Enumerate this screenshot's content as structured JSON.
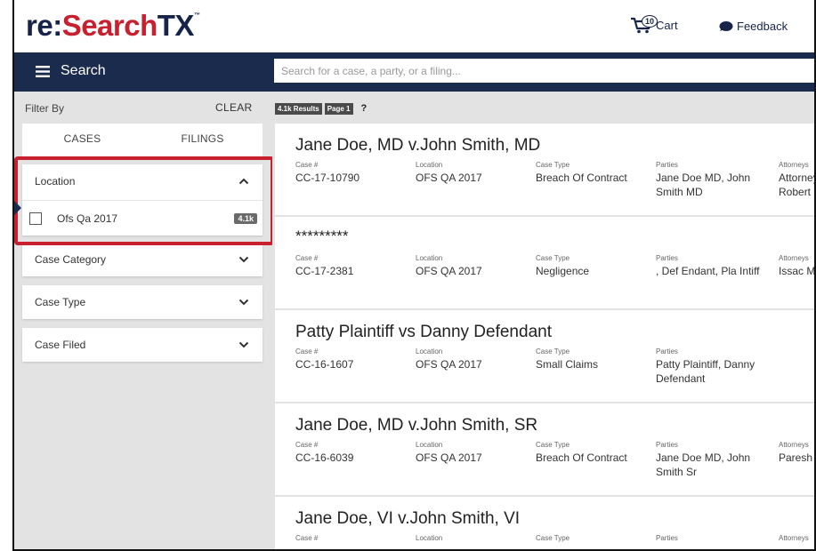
{
  "app": {
    "logo": {
      "part1": "re:",
      "part2": "Search",
      "part3": "TX",
      "tm": "™"
    },
    "cart": {
      "label": "Cart",
      "count": "10"
    },
    "feedback": {
      "label": "Feedback"
    }
  },
  "navbar": {
    "menu_label": "Search",
    "search_placeholder": "Search for a case, a party, or a filing..."
  },
  "sidebar": {
    "filter_by": "Filter By",
    "clear": "CLEAR",
    "tabs": [
      "CASES",
      "FILINGS"
    ],
    "location": {
      "label": "Location",
      "option": "Ofs Qa 2017",
      "count": "4.1k"
    },
    "case_category": "Case Category",
    "case_type": "Case Type",
    "case_filed": "Case Filed"
  },
  "results": {
    "count": "4.1k Results",
    "page": "Page 1",
    "help": "?",
    "labels": {
      "case_no": "Case #",
      "location": "Location",
      "case_type": "Case Type",
      "parties": "Parties",
      "attorneys": "Attorneys"
    },
    "cards": [
      {
        "title": "Jane Doe, MD v.John Smith, MD",
        "case_no": "CC-17-10790",
        "location": "OFS QA 2017",
        "case_type": "Breach Of Contract",
        "parties": "Jane Doe MD, John Smith MD",
        "attorneys": "Attorney Robert"
      },
      {
        "title": "*********",
        "case_no": "CC-17-2381",
        "location": "OFS QA 2017",
        "case_type": "Negligence",
        "parties": ", Def Endant, Pla Intiff",
        "attorneys": "Issac M"
      },
      {
        "title": "Patty Plaintiff vs Danny Defendant",
        "case_no": "CC-16-1607",
        "location": "OFS QA 2017",
        "case_type": "Small Claims",
        "parties": "Patty Plaintiff, Danny Defendant",
        "attorneys": ""
      },
      {
        "title": "Jane Doe, MD v.John Smith, SR",
        "case_no": "CC-16-6039",
        "location": "OFS QA 2017",
        "case_type": "Breach Of Contract",
        "parties": "Jane Doe MD, John Smith Sr",
        "attorneys": "Paresh"
      },
      {
        "title": "Jane Doe, VI v.John Smith, VI",
        "case_no": "",
        "location": "",
        "case_type": "",
        "parties": "",
        "attorneys": ""
      }
    ]
  },
  "colors": {
    "navy": "#1b2b4d",
    "brand_red": "#c8202f",
    "sidebar_bg": "#e3e3e3"
  },
  "icons": [
    "cart-icon",
    "feedback-icon",
    "hamburger-icon",
    "chevron-up-icon",
    "chevron-down-icon",
    "checkbox-icon"
  ]
}
